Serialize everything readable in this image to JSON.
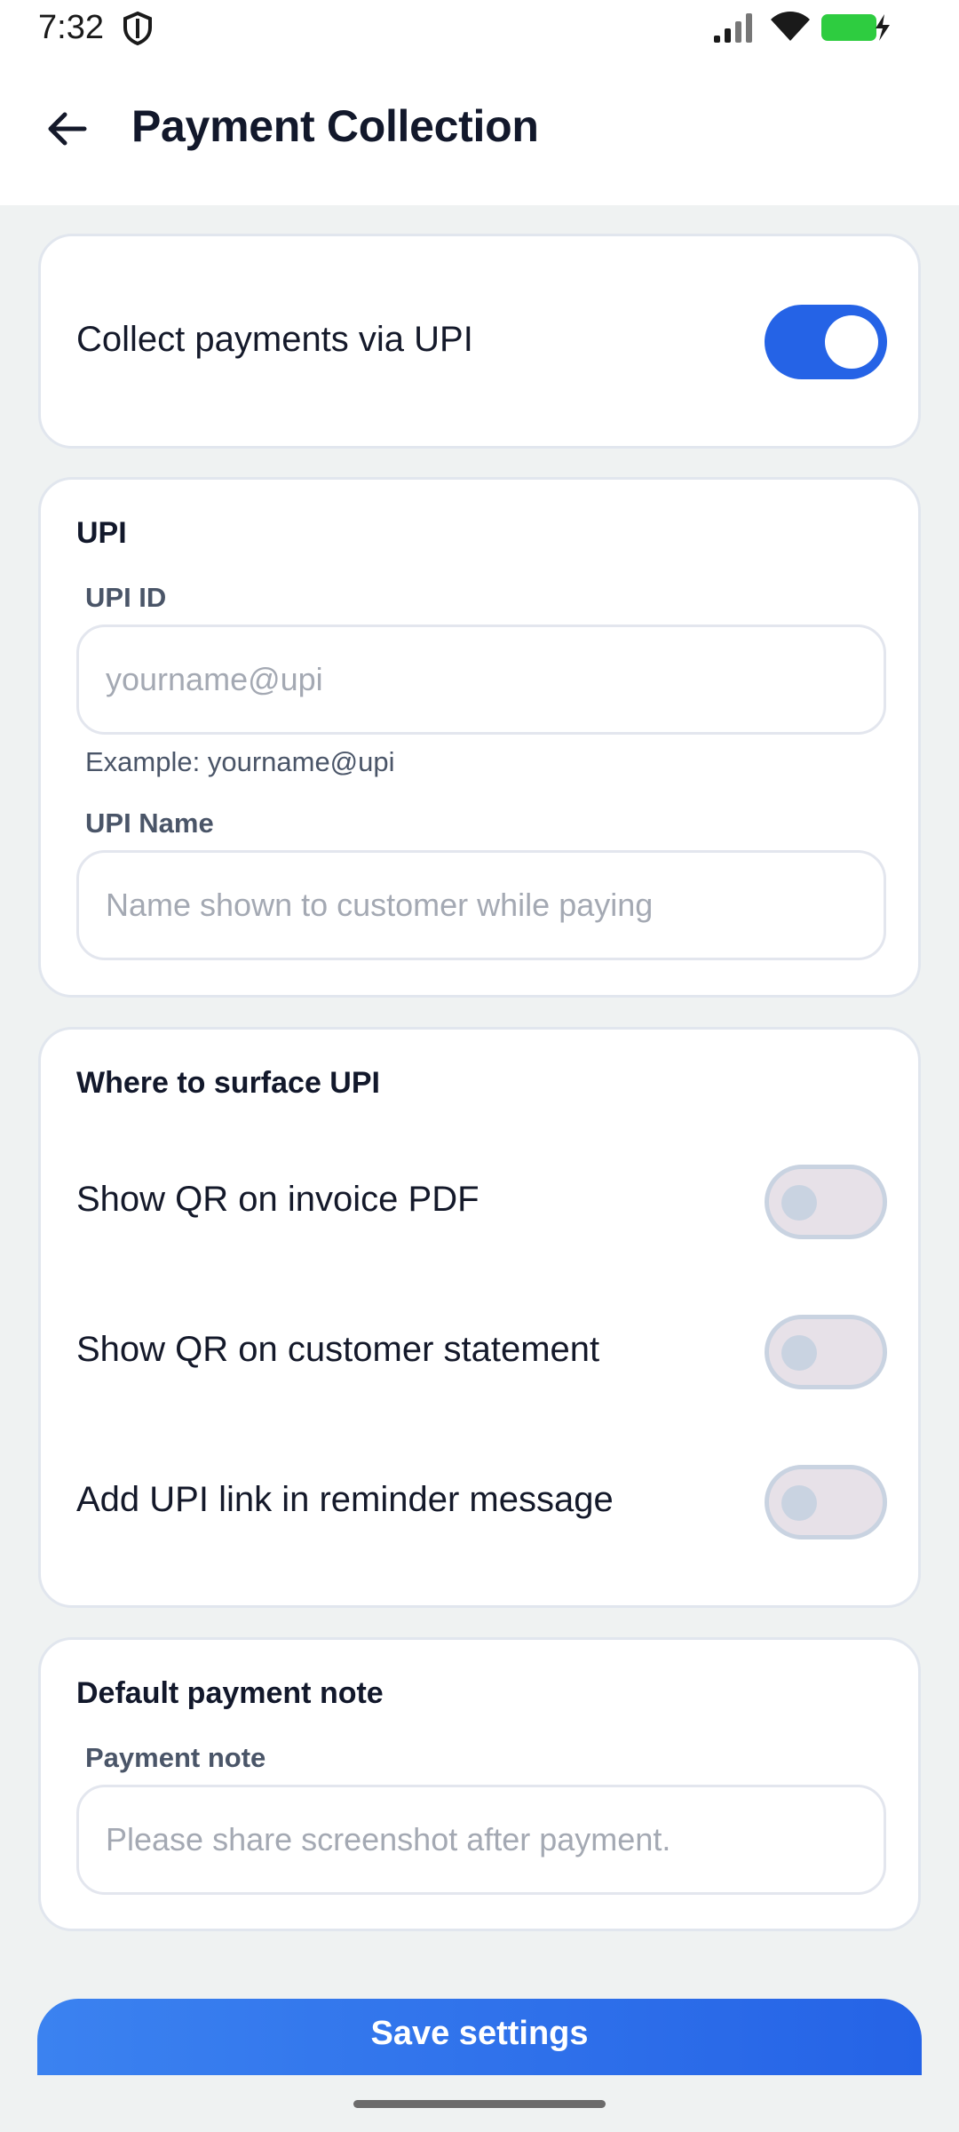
{
  "status_bar": {
    "time": "7:32",
    "icons": [
      "shield-icon",
      "signal-icon",
      "wifi-icon",
      "battery-charging-icon"
    ],
    "battery_color": "#2ecc40"
  },
  "header": {
    "back_icon": "arrow-left-icon",
    "title": "Payment Collection"
  },
  "collect_card": {
    "label": "Collect payments via UPI",
    "enabled": true
  },
  "upi_card": {
    "title": "UPI",
    "upi_id_label": "UPI ID",
    "upi_id_placeholder": "yourname@upi",
    "upi_id_value": "",
    "upi_id_helper": "Example: yourname@upi",
    "upi_name_label": "UPI Name",
    "upi_name_placeholder": "Name shown to customer while paying",
    "upi_name_value": ""
  },
  "surface_card": {
    "title": "Where to surface UPI",
    "options": [
      {
        "label": "Show QR on invoice PDF",
        "enabled": false
      },
      {
        "label": "Show QR on customer statement",
        "enabled": false
      },
      {
        "label": "Add UPI link in reminder message",
        "enabled": false
      }
    ]
  },
  "note_card": {
    "title": "Default payment note",
    "field_label": "Payment note",
    "placeholder": "Please share screenshot after payment.",
    "value": ""
  },
  "footer": {
    "save_label": "Save settings"
  },
  "colors": {
    "accent": "#2563e6",
    "background": "#eff2f2",
    "card": "#ffffff",
    "toggle_off": "#e7e1e8"
  }
}
